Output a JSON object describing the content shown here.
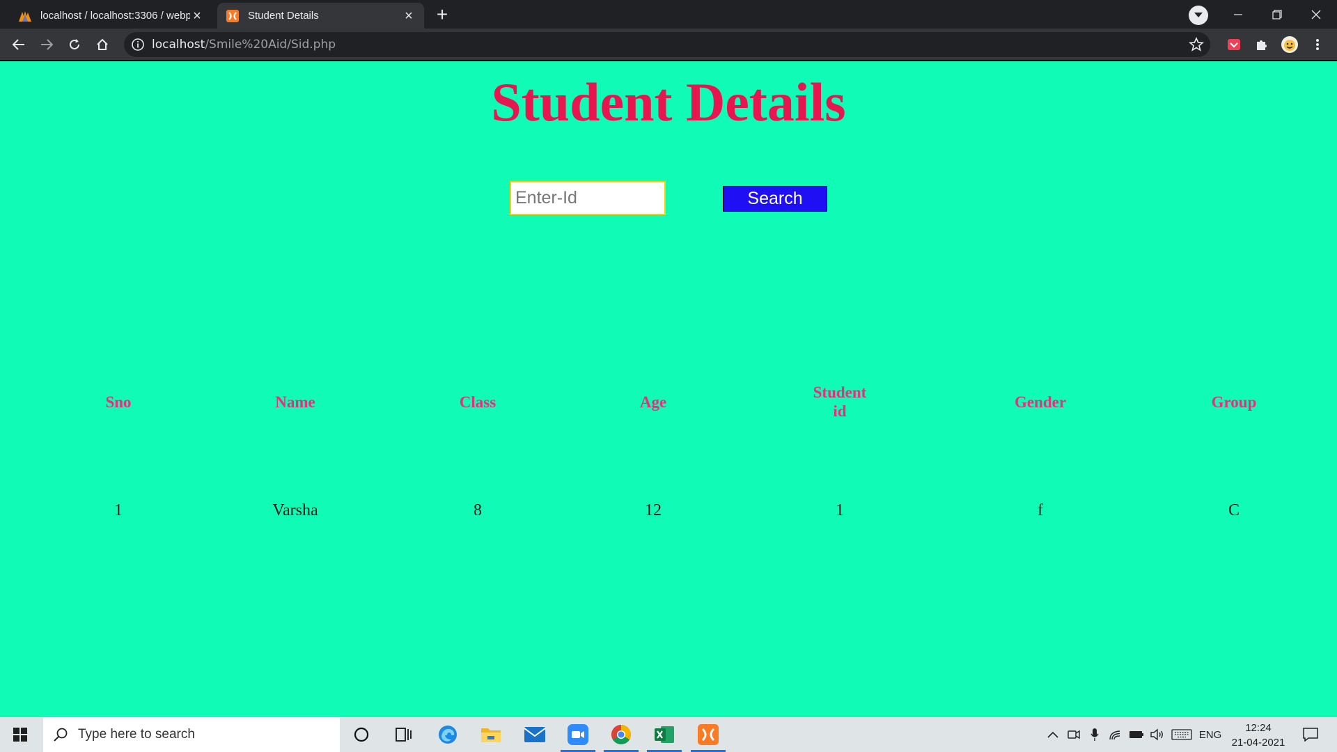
{
  "browser": {
    "tabs": [
      {
        "title": "localhost / localhost:3306 / webp",
        "active": false,
        "icon": "phpmyadmin-icon"
      },
      {
        "title": "Student Details",
        "active": true,
        "icon": "xampp-icon"
      }
    ],
    "url": {
      "host": "localhost",
      "path": "/Smile%20Aid/Sid.php"
    }
  },
  "page": {
    "title": "Student Details",
    "search": {
      "placeholder": "Enter-Id",
      "value": "",
      "button_label": "Search"
    },
    "table": {
      "headers": [
        "Sno",
        "Name",
        "Class",
        "Age",
        "Student id",
        "Gender",
        "Group"
      ],
      "rows": [
        [
          "1",
          "Varsha",
          "8",
          "12",
          "1",
          "f",
          "C"
        ]
      ]
    }
  },
  "taskbar": {
    "search_placeholder": "Type here to search",
    "language": "ENG",
    "time": "12:24",
    "date": "21-04-2021"
  },
  "colors": {
    "page_background": "#10fbb6",
    "title": "#e8164f",
    "header_text": "#e5317d",
    "search_button": "#1e0ff5"
  }
}
